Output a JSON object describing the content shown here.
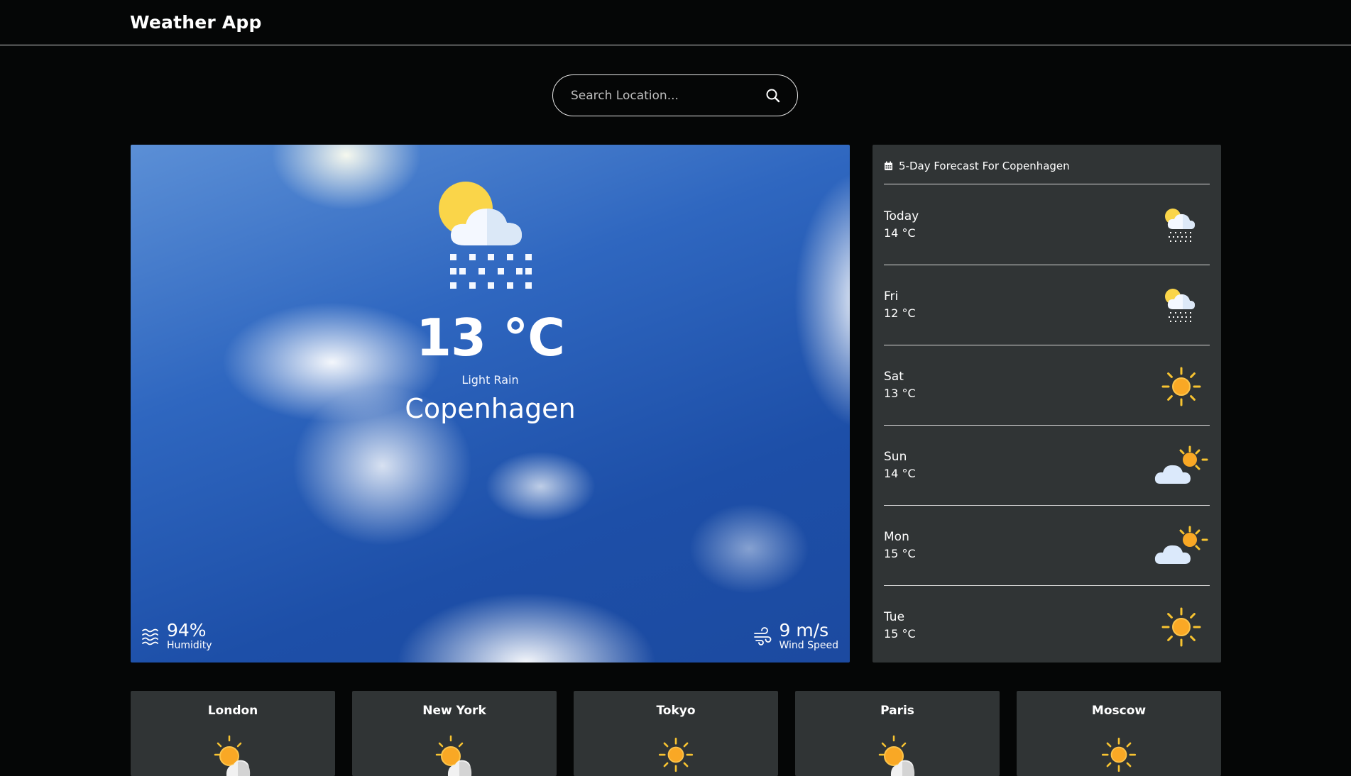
{
  "header": {
    "title": "Weather App"
  },
  "search": {
    "placeholder": "Search Location..."
  },
  "current": {
    "temperature": "13 °C",
    "condition": "Light Rain",
    "city": "Copenhagen",
    "icon": "partly-cloudy-rain-icon",
    "humidity_value": "94%",
    "humidity_label": "Humidity",
    "wind_value": "9 m/s",
    "wind_label": "Wind Speed"
  },
  "forecast": {
    "title": "5-Day Forecast For Copenhagen",
    "days": [
      {
        "day": "Today",
        "temp": "14 °C",
        "icon": "partly-cloudy-snow-icon"
      },
      {
        "day": "Fri",
        "temp": "12 °C",
        "icon": "partly-cloudy-snow-icon"
      },
      {
        "day": "Sat",
        "temp": "13 °C",
        "icon": "sun-icon"
      },
      {
        "day": "Sun",
        "temp": "14 °C",
        "icon": "cloud-sun-icon"
      },
      {
        "day": "Mon",
        "temp": "15 °C",
        "icon": "cloud-sun-icon"
      },
      {
        "day": "Tue",
        "temp": "15 °C",
        "icon": "sun-icon"
      }
    ]
  },
  "cities": [
    {
      "name": "London",
      "icon": "sun-cloud-icon"
    },
    {
      "name": "New York",
      "icon": "sun-cloud-icon"
    },
    {
      "name": "Tokyo",
      "icon": "sun-icon"
    },
    {
      "name": "Paris",
      "icon": "sun-cloud-icon"
    },
    {
      "name": "Moscow",
      "icon": "sun-icon"
    }
  ],
  "colors": {
    "background": "#050606",
    "panel": "#303435",
    "sun": "#f9b233",
    "sun_ray": "#f7c331"
  }
}
